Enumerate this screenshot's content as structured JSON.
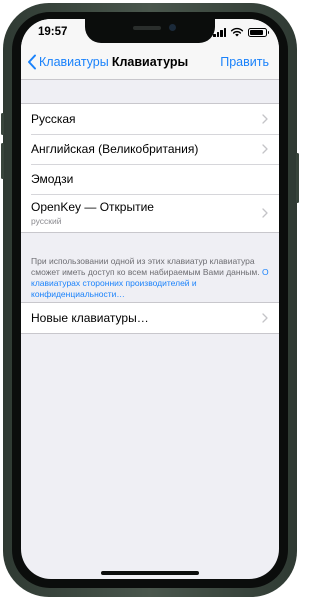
{
  "status": {
    "time": "19:57",
    "battery_level": 0.85
  },
  "nav": {
    "back_label": "Клавиатуры",
    "title": "Клавиатуры",
    "edit_label": "Править"
  },
  "keyboards": [
    {
      "label": "Русская",
      "has_chevron": true
    },
    {
      "label": "Английская (Великобритания)",
      "has_chevron": true
    },
    {
      "label": "Эмодзи",
      "has_chevron": false
    },
    {
      "label": "OpenKey — Открытие",
      "sublabel": "русский",
      "has_chevron": true
    }
  ],
  "footer": {
    "text": "При использовании одной из этих клавиатур клавиатура сможет иметь доступ ко всем набираемым Вами данным.",
    "link": "О клавиатурах сторонних производителей и конфиденциальности…"
  },
  "new_keyboard": {
    "label": "Новые клавиатуры…"
  },
  "colors": {
    "accent": "#1a82fb",
    "background": "#efeff4",
    "frame": "#3e4a41"
  }
}
